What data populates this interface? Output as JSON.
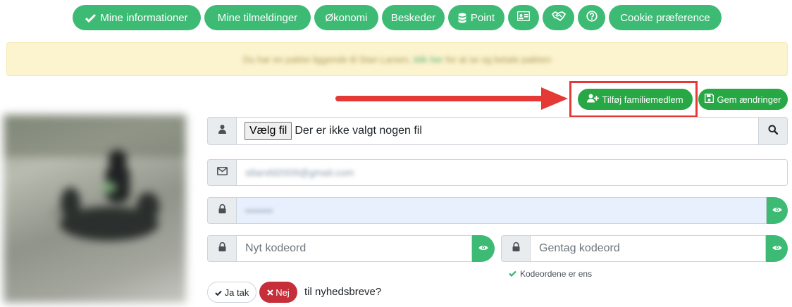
{
  "nav": {
    "mine_informationer": "Mine informationer",
    "mine_tilmeldinger": "Mine tilmeldinger",
    "okonomi": "Økonomi",
    "beskeder": "Beskeder",
    "point": "Point",
    "cookie": "Cookie præference",
    "icons": [
      "check-icon",
      "coins-icon",
      "id-card-icon",
      "handshake-icon",
      "question-circle-icon"
    ]
  },
  "alert": {
    "text_before": "Du har en pakke liggende til Stan Larsen,",
    "link": "klik her",
    "text_after": "for at se og betale pakken"
  },
  "actions": {
    "add_family_member": "Tilføj familiemedlem",
    "save_changes": "Gem ændringer"
  },
  "form": {
    "file_button": "Vælg fil",
    "file_status": "Der er ikke valgt nogen fil",
    "email_value": "stlarsfd2009@gmail.com",
    "password_masked": "••••••••",
    "new_password_placeholder": "Nyt kodeord",
    "repeat_password_placeholder": "Gentag kodeord",
    "password_match_note": "Kodeordene er ens"
  },
  "newsletter": {
    "yes_label": "Ja tak",
    "no_label": "Nej",
    "suffix_text": "til nyhedsbreve?"
  },
  "colors": {
    "green": "#3dbb74",
    "red_button": "#c62e3a",
    "alert_bg": "#fcf3cf",
    "highlight": "#e53935"
  }
}
